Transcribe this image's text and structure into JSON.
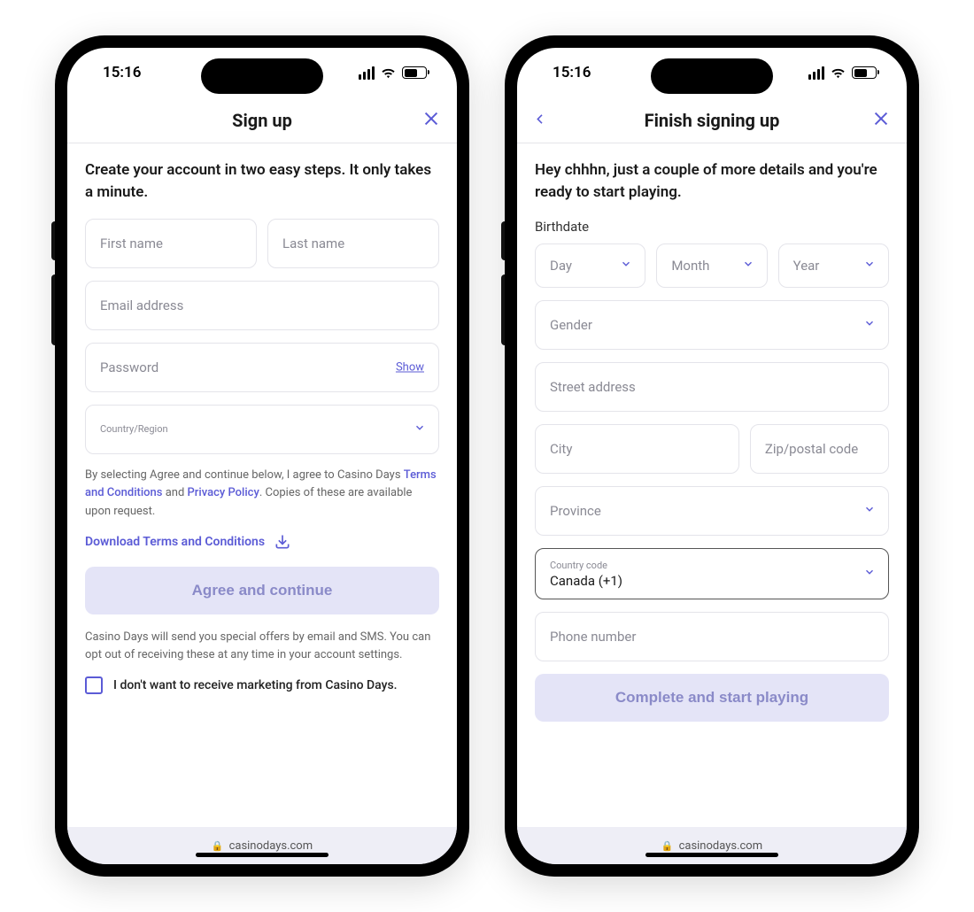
{
  "status": {
    "time": "15:16"
  },
  "browser": {
    "domain": "casinodays.com"
  },
  "screen1": {
    "title": "Sign up",
    "intro": "Create your account in two easy steps. It only takes a minute.",
    "first_name_ph": "First name",
    "last_name_ph": "Last name",
    "email_ph": "Email address",
    "password_ph": "Password",
    "show": "Show",
    "country_label": "Country/Region",
    "legal_prefix": "By selecting Agree and continue below, I agree to Casino Days ",
    "terms": "Terms and Conditions",
    "legal_and": " and ",
    "privacy": "Privacy Policy",
    "legal_suffix": ". Copies of these are available upon request.",
    "download": "Download Terms and Conditions",
    "cta": "Agree and continue",
    "opt_text": "Casino Days will send you special offers by email and SMS. You can opt out of receiving these at any time in your account settings.",
    "checkbox_label": "I don't want to receive marketing from Casino Days."
  },
  "screen2": {
    "title": "Finish signing up",
    "intro": "Hey chhhn, just a couple of more details and you're ready to start playing.",
    "birthdate_label": "Birthdate",
    "day": "Day",
    "month": "Month",
    "year": "Year",
    "gender": "Gender",
    "street": "Street address",
    "city": "City",
    "zip": "Zip/postal code",
    "province": "Province",
    "country_code_label": "Country code",
    "country_code_value": "Canada (+1)",
    "phone": "Phone number",
    "cta": "Complete and start playing"
  }
}
